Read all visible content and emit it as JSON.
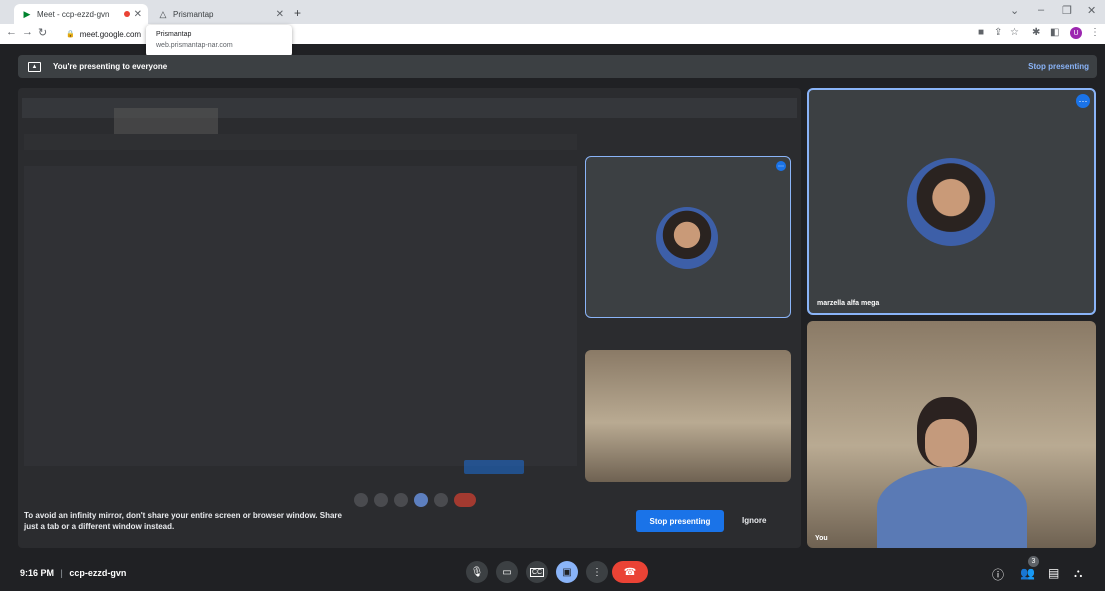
{
  "browser": {
    "tabs": [
      {
        "title": "Meet - ccp-ezzd-gvn"
      },
      {
        "title": "Prismantap"
      }
    ],
    "url": "meet.google.com",
    "new_tab": "+",
    "tooltip": {
      "title": "Prismantap",
      "url": "web.prismantap-nar.com"
    }
  },
  "banner": {
    "text": "You're presenting to everyone",
    "stop_label": "Stop presenting"
  },
  "participants": [
    {
      "name": "marzella alfa mega"
    },
    {
      "name": "You"
    }
  ],
  "notice": {
    "line1": "To avoid an infinity mirror, don't share your entire screen or browser window. Share",
    "line2": "just a tab or a different window instead.",
    "stop_label": "Stop presenting",
    "ignore_label": "Ignore"
  },
  "bottom": {
    "time": "9:16 PM",
    "separator": "|",
    "meeting_code": "ccp-ezzd-gvn",
    "people_count": "3"
  },
  "colors": {
    "accent": "#1a73e8",
    "end_call": "#ea4335",
    "link": "#8ab4f8"
  }
}
